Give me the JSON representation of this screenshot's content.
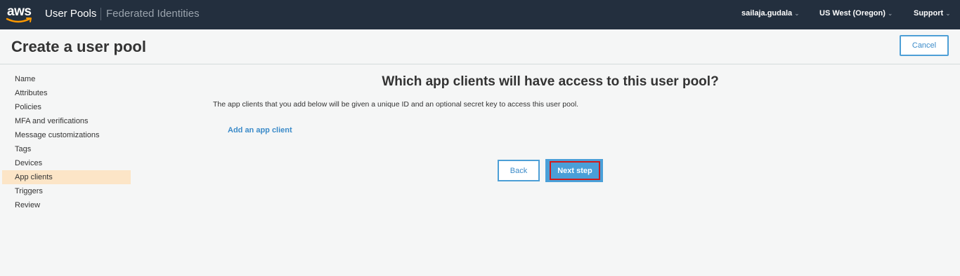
{
  "topbar": {
    "logo_text": "aws",
    "service": "User Pools",
    "federated": "Federated Identities",
    "user": "sailaja.gudala",
    "region": "US West (Oregon)",
    "support": "Support",
    "caret": "⌄"
  },
  "header": {
    "title": "Create a user pool",
    "cancel_label": "Cancel"
  },
  "sidebar": {
    "items": [
      {
        "label": "Name"
      },
      {
        "label": "Attributes"
      },
      {
        "label": "Policies"
      },
      {
        "label": "MFA and verifications"
      },
      {
        "label": "Message customizations"
      },
      {
        "label": "Tags"
      },
      {
        "label": "Devices"
      },
      {
        "label": "App clients",
        "active": true
      },
      {
        "label": "Triggers"
      },
      {
        "label": "Review"
      }
    ]
  },
  "main": {
    "heading": "Which app clients will have access to this user pool?",
    "description": "The app clients that you add below will be given a unique ID and an optional secret key to access this user pool.",
    "add_client_label": "Add an app client",
    "back_label": "Back",
    "next_label": "Next step"
  },
  "colors": {
    "topbar_bg": "#232f3e",
    "accent_blue": "#4a9fd8",
    "active_item_bg": "#fce5c7",
    "highlight_border": "#d11a1a"
  }
}
